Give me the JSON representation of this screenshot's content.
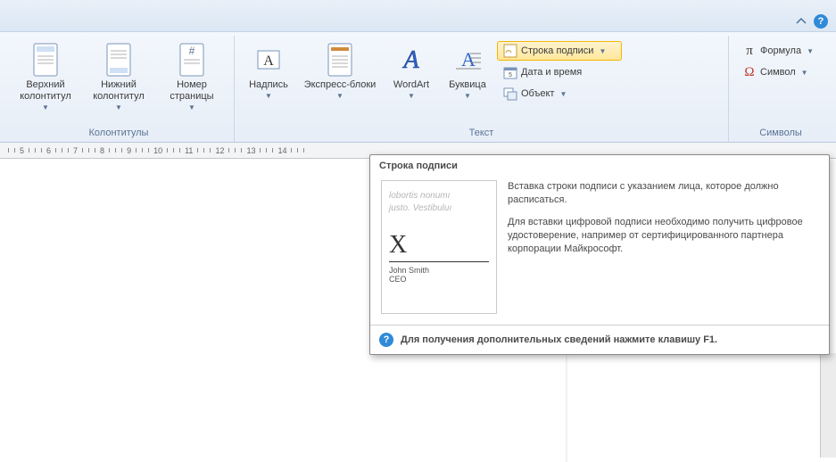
{
  "titlebar": {
    "minimize_icon": "minimize-ribbon-icon",
    "help_icon": "help-icon"
  },
  "ribbon": {
    "groups": {
      "headers_footers": {
        "title": "Колонтитулы",
        "header_btn": "Верхний колонтитул",
        "footer_btn": "Нижний колонтитул",
        "page_number_btn": "Номер страницы"
      },
      "text": {
        "title": "Текст",
        "textbox_btn": "Надпись",
        "quickparts_btn": "Экспресс-блоки",
        "wordart_btn": "WordArt",
        "dropcap_btn": "Буквица",
        "signature_line_btn": "Строка подписи",
        "date_time_btn": "Дата и время",
        "object_btn": "Объект"
      },
      "symbols": {
        "title": "Символы",
        "equation_btn": "Формула",
        "symbol_btn": "Символ"
      }
    }
  },
  "ruler": {
    "numbers": [
      "5",
      "6",
      "7",
      "8",
      "9",
      "10",
      "11",
      "12",
      "13",
      "14"
    ]
  },
  "tooltip": {
    "title": "Строка подписи",
    "preview": {
      "lorem1": "lobortis nonumı",
      "lorem2": "justo. Vestibuluı",
      "sig_x": "X",
      "sig_name": "John Smith",
      "sig_role": "CEO"
    },
    "para1": "Вставка строки подписи с указанием лица, которое должно расписаться.",
    "para2": "Для вставки цифровой подписи необходимо получить цифровое удостоверение, например от сертифицированного партнера корпорации Майкрософт.",
    "footer": "Для получения дополнительных сведений нажмите клавишу F1."
  }
}
